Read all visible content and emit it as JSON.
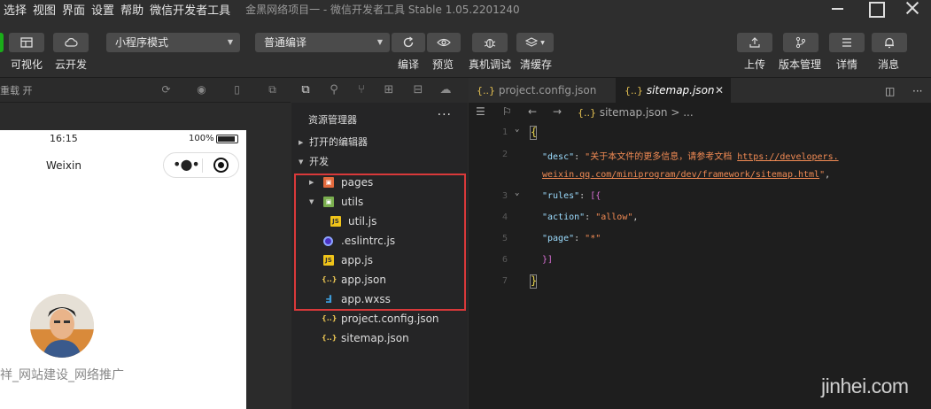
{
  "menubar": {
    "items": [
      "选择",
      "视图",
      "界面",
      "设置",
      "帮助",
      "微信开发者工具"
    ],
    "window_title": "金黑网络项目一 - 微信开发者工具 Stable 1.05.2201240"
  },
  "toolbar": {
    "visual_label": "可视化",
    "cloud_label": "云开发",
    "mode_select": "小程序模式",
    "compile_select": "普通编译",
    "compile_label": "编译",
    "preview_label": "预览",
    "debug_label": "真机调试",
    "cache_label": "清缓存",
    "upload_label": "上传",
    "version_label": "版本管理",
    "details_label": "详情",
    "messages_label": "消息"
  },
  "simulator": {
    "zoom_label": "重载 开",
    "status_time": "16:15",
    "battery_pct": "100%",
    "nav_title": "Weixin",
    "footer_text": "祥_网站建设_网络推广"
  },
  "explorer": {
    "title": "资源管理器",
    "more": "···",
    "open_editors": "打开的编辑器",
    "project_section": "开发",
    "files": [
      {
        "name": "pages",
        "icon": "folder-pages-icon"
      },
      {
        "name": "utils",
        "icon": "folder-utils-icon"
      },
      {
        "name": "util.js",
        "icon": "js-file-icon"
      },
      {
        "name": ".eslintrc.js",
        "icon": "eslint-file-icon"
      },
      {
        "name": "app.js",
        "icon": "js-file-icon"
      },
      {
        "name": "app.json",
        "icon": "json-file-icon"
      },
      {
        "name": "app.wxss",
        "icon": "css-file-icon"
      },
      {
        "name": "project.config.json",
        "icon": "json-file-icon"
      },
      {
        "name": "sitemap.json",
        "icon": "json-file-icon"
      }
    ]
  },
  "editor": {
    "tabs": [
      {
        "label": "project.config.json",
        "active": false
      },
      {
        "label": "sitemap.json",
        "active": true
      }
    ],
    "breadcrumb": "sitemap.json > ...",
    "line_numbers": [
      "1",
      "2",
      "3",
      "4",
      "5",
      "6",
      "7"
    ],
    "code": {
      "open_brace": "{",
      "desc_key": "\"desc\"",
      "desc_value": "\"关于本文件的更多信息，请参考文档 ",
      "desc_url_1": "https://developers.",
      "desc_url_2": "weixin.qq.com/miniprogram/dev/framework/sitemap.html",
      "desc_end": "\"",
      "rules_key": "\"rules\"",
      "rules_open": "[{",
      "action_key": "\"action\"",
      "action_value": "\"allow\"",
      "page_key": "\"page\"",
      "page_value": "\"*\"",
      "rules_close": "}]",
      "close_brace": "}"
    }
  },
  "watermark": "jinhei.com",
  "colors": {
    "highlight_box": "#d9393a",
    "accent_green": "#1aad19",
    "string_color": "#f28b54",
    "key_color": "#9cdcfe"
  }
}
